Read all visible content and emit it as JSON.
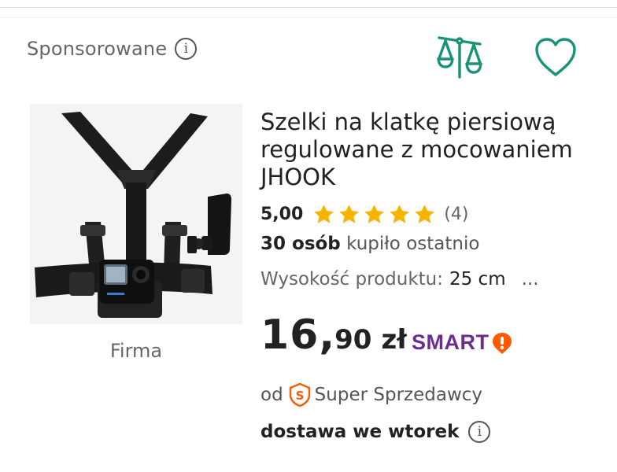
{
  "sponsored": {
    "label": "Sponsorowane",
    "info_icon": "info-icon"
  },
  "actions": {
    "compare_icon": "scales-icon",
    "wishlist_icon": "heart-icon",
    "accent_color": "#1a9278"
  },
  "product": {
    "title": "Szelki na klatkę piersiową regulowane z mocowaniem JHOOK",
    "brand": "Firma",
    "rating": {
      "value": "5,00",
      "stars": 5,
      "max_stars": 5,
      "count": "(4)",
      "star_color": "#f5b400"
    },
    "bought": {
      "count": "30 osób",
      "text": "kupiło ostatnio"
    },
    "parameter": {
      "name": "Wysokość produktu:",
      "value": "25 cm",
      "more": "..."
    },
    "price": {
      "integer": "16",
      "comma": ",",
      "decimal": "90",
      "currency": "zł"
    },
    "smart": {
      "label": "SMART",
      "brand_color": "#6b2d8f",
      "badge_color": "#ff5a00"
    },
    "seller": {
      "prefix": "od",
      "label": "Super Sprzedawcy",
      "icon": "super-seller-icon"
    },
    "delivery": {
      "label": "dostawa we wtorek",
      "info_icon": "info-icon"
    }
  }
}
